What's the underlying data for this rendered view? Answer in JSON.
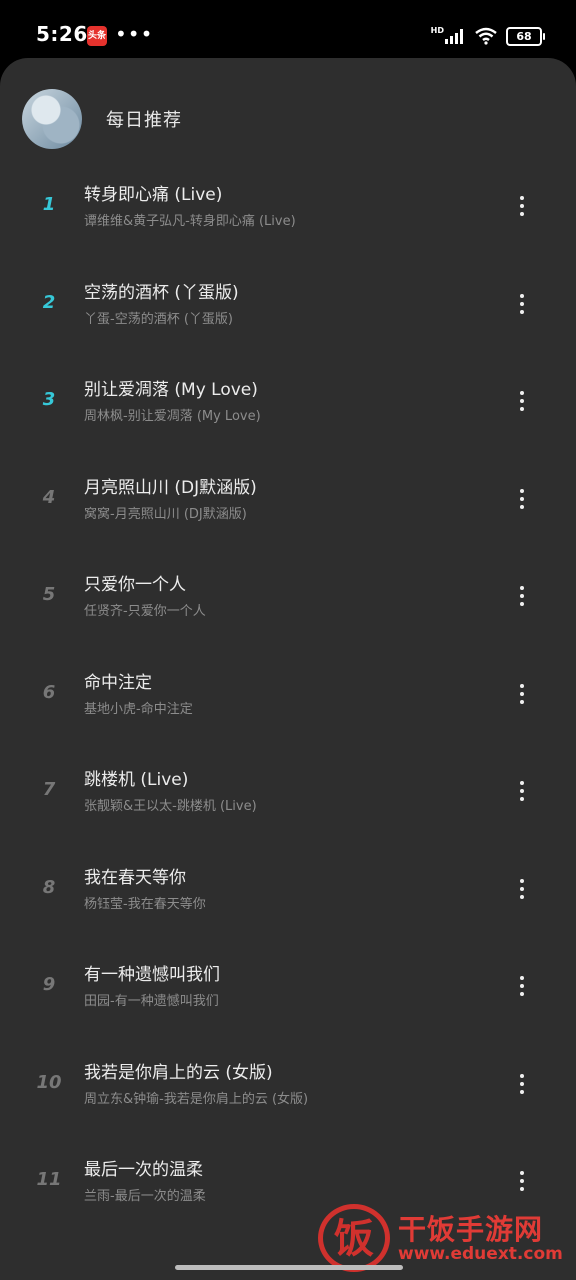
{
  "status_bar": {
    "time": "5:26",
    "app_badge": "头条",
    "more": "•••",
    "hd": "HD",
    "battery": "68"
  },
  "header": {
    "title": "每日推荐"
  },
  "songs": [
    {
      "index": "1",
      "title": "转身即心痛 (Live)",
      "subtitle": "谭维维&黄子弘凡-转身即心痛 (Live)"
    },
    {
      "index": "2",
      "title": "空荡的酒杯 (丫蛋版)",
      "subtitle": "丫蛋-空荡的酒杯 (丫蛋版)"
    },
    {
      "index": "3",
      "title": "别让爱凋落 (My Love)",
      "subtitle": "周林枫-别让爱凋落 (My Love)"
    },
    {
      "index": "4",
      "title": "月亮照山川 (DJ默涵版)",
      "subtitle": "窝窝-月亮照山川 (DJ默涵版)"
    },
    {
      "index": "5",
      "title": "只爱你一个人",
      "subtitle": "任贤齐-只爱你一个人"
    },
    {
      "index": "6",
      "title": "命中注定",
      "subtitle": "基地小虎-命中注定"
    },
    {
      "index": "7",
      "title": "跳楼机 (Live)",
      "subtitle": "张靓颖&王以太-跳楼机 (Live)"
    },
    {
      "index": "8",
      "title": "我在春天等你",
      "subtitle": "杨钰莹-我在春天等你"
    },
    {
      "index": "9",
      "title": "有一种遗憾叫我们",
      "subtitle": "田园-有一种遗憾叫我们"
    },
    {
      "index": "10",
      "title": "我若是你肩上的云 (女版)",
      "subtitle": "周立东&钟瑜-我若是你肩上的云 (女版)"
    },
    {
      "index": "11",
      "title": "最后一次的温柔",
      "subtitle": "兰雨-最后一次的温柔"
    }
  ],
  "watermark": {
    "logo": "饭",
    "name": "干饭手游网",
    "url": "www.eduext.com"
  },
  "colors": {
    "panel_bg": "#2e2e2e",
    "top_rank_accent": "#36c8d8",
    "watermark_red": "#e03b36"
  }
}
